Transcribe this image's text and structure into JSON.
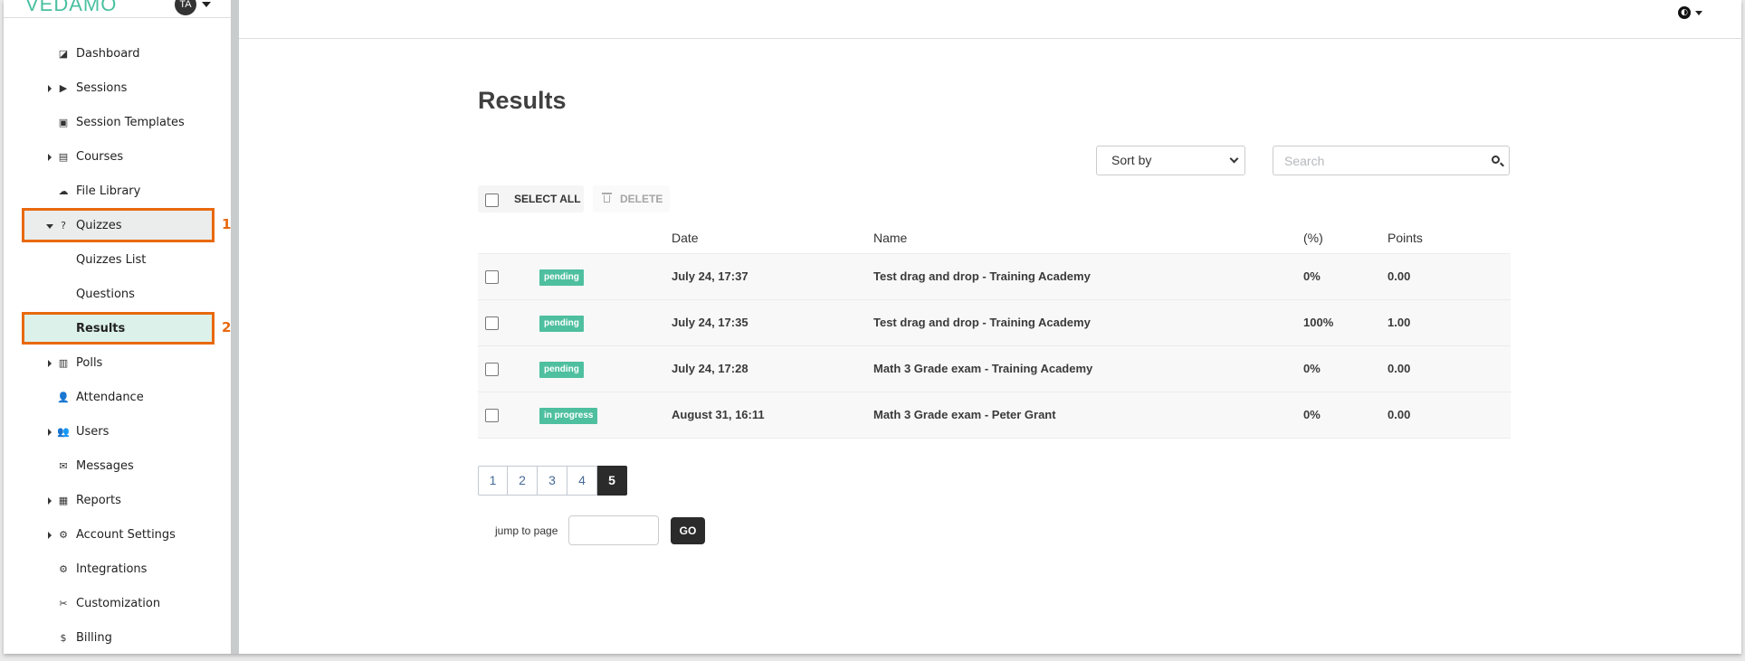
{
  "brand": {
    "logo": "VEDAMO",
    "avatar_initials": "TA"
  },
  "sidebar": {
    "items": [
      {
        "label": "Dashboard",
        "icon": "dashboard-icon",
        "glyph": "◪",
        "expandable": false,
        "sub": false
      },
      {
        "label": "Sessions",
        "icon": "play-circle-icon",
        "glyph": "▶",
        "expandable": true,
        "sub": false
      },
      {
        "label": "Session Templates",
        "icon": "template-icon",
        "glyph": "▣",
        "expandable": false,
        "sub": false
      },
      {
        "label": "Courses",
        "icon": "book-icon",
        "glyph": "▤",
        "expandable": true,
        "sub": false
      },
      {
        "label": "File Library",
        "icon": "cloud-upload-icon",
        "glyph": "☁",
        "expandable": false,
        "sub": false
      },
      {
        "label": "Quizzes",
        "icon": "question-circle-icon",
        "glyph": "?",
        "expandable": true,
        "expanded": true,
        "sub": false
      },
      {
        "label": "Quizzes List",
        "sub": true
      },
      {
        "label": "Questions",
        "sub": true
      },
      {
        "label": "Results",
        "sub": true,
        "selected": true
      },
      {
        "label": "Polls",
        "icon": "bar-chart-icon",
        "glyph": "▥",
        "expandable": true,
        "sub": false
      },
      {
        "label": "Attendance",
        "icon": "user-check-icon",
        "glyph": "👤",
        "expandable": false,
        "sub": false
      },
      {
        "label": "Users",
        "icon": "users-icon",
        "glyph": "👥",
        "expandable": true,
        "sub": false
      },
      {
        "label": "Messages",
        "icon": "envelope-icon",
        "glyph": "✉",
        "expandable": false,
        "sub": false
      },
      {
        "label": "Reports",
        "icon": "report-chart-icon",
        "glyph": "▦",
        "expandable": true,
        "sub": false
      },
      {
        "label": "Account Settings",
        "icon": "gear-icon",
        "glyph": "⚙",
        "expandable": true,
        "sub": false
      },
      {
        "label": "Integrations",
        "icon": "cogs-icon",
        "glyph": "⚙",
        "expandable": false,
        "sub": false
      },
      {
        "label": "Customization",
        "icon": "tools-icon",
        "glyph": "✂",
        "expandable": false,
        "sub": false
      },
      {
        "label": "Billing",
        "icon": "invoice-icon",
        "glyph": "$",
        "expandable": false,
        "sub": false
      }
    ]
  },
  "annotations": {
    "box1_number": "1",
    "box2_number": "2",
    "color": "#e8690f"
  },
  "header": {
    "language_icon": "globe-icon"
  },
  "main": {
    "title": "Results",
    "sort": {
      "selected": "Sort by"
    },
    "search": {
      "placeholder": "Search",
      "value": ""
    },
    "bulk": {
      "select_all": "SELECT ALL",
      "delete": "DELETE"
    },
    "table": {
      "columns": [
        "",
        "",
        "Date",
        "Name",
        "(%)",
        "Points"
      ],
      "rows": [
        {
          "status": "pending",
          "date": "July 24, 17:37",
          "name": "Test drag and drop - Training Academy",
          "percent": "0%",
          "points": "0.00"
        },
        {
          "status": "pending",
          "date": "July 24, 17:35",
          "name": "Test drag and drop - Training Academy",
          "percent": "100%",
          "points": "1.00"
        },
        {
          "status": "pending",
          "date": "July 24, 17:28",
          "name": "Math 3 Grade exam - Training Academy",
          "percent": "0%",
          "points": "0.00"
        },
        {
          "status": "in progress",
          "date": "August 31, 16:11",
          "name": "Math 3 Grade exam - Peter Grant",
          "percent": "0%",
          "points": "0.00"
        }
      ]
    },
    "pagination": {
      "pages": [
        "1",
        "2",
        "3",
        "4",
        "5"
      ],
      "current": "5"
    },
    "jump": {
      "label": "jump to page",
      "value": "",
      "go_label": "GO"
    }
  },
  "colors": {
    "brand": "#49c0a0",
    "badge": "#4ebf9f",
    "highlight": "#e8690f",
    "selected_bg": "#dcf1ea"
  }
}
